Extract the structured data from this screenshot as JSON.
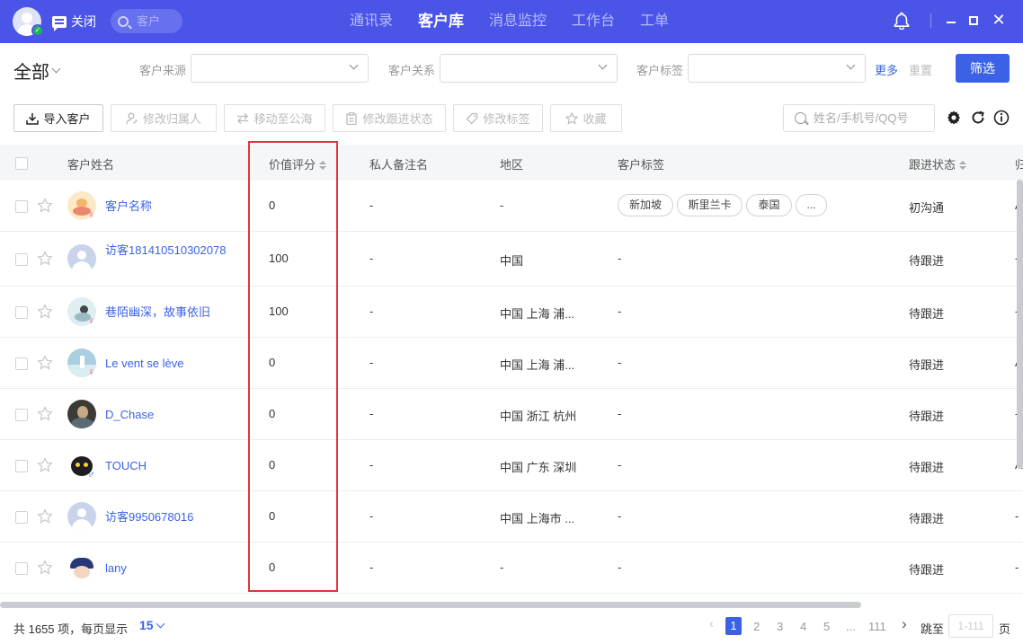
{
  "topbar": {
    "close_label": "关闭",
    "search_placeholder": "客户",
    "nav": [
      "通讯录",
      "客户库",
      "消息监控",
      "工作台",
      "工单"
    ],
    "active_nav": 1
  },
  "filters": {
    "scope": "全部",
    "source_label": "客户来源",
    "relation_label": "客户关系",
    "tag_label": "客户标签",
    "more": "更多",
    "reset": "重置",
    "submit": "筛选"
  },
  "toolbar": {
    "import": "导入客户",
    "change_owner": "修改归属人",
    "move_pool": "移动至公海",
    "change_status": "修改跟进状态",
    "change_tags": "修改标签",
    "favorite": "收藏",
    "search_placeholder": "姓名/手机号/QQ号"
  },
  "table": {
    "headers": {
      "name": "客户姓名",
      "score": "价值评分",
      "remark": "私人备注名",
      "region": "地区",
      "tags": "客户标签",
      "status": "跟进状态",
      "owner": "归"
    },
    "rows": [
      {
        "name": "客户名称",
        "score": "0",
        "remark": "-",
        "region": "-",
        "tags": [
          "新加坡",
          "斯里兰卡",
          "泰国",
          "..."
        ],
        "status": "初沟通",
        "owner": "A"
      },
      {
        "name": "访客181410510302078",
        "score": "100",
        "remark": "-",
        "region": "中国",
        "tags": [],
        "tags_text": "-",
        "status": "待跟进",
        "owner": "-"
      },
      {
        "name": "巷陌幽深，故事依旧",
        "score": "100",
        "remark": "-",
        "region": "中国 上海 浦...",
        "tags": [],
        "tags_text": "-",
        "status": "待跟进",
        "owner": "-"
      },
      {
        "name": "Le vent se lève",
        "score": "0",
        "remark": "-",
        "region": "中国 上海 浦...",
        "tags": [],
        "tags_text": "-",
        "status": "待跟进",
        "owner": "A"
      },
      {
        "name": "D_Chase",
        "score": "0",
        "remark": "-",
        "region": "中国 浙江 杭州",
        "tags": [],
        "tags_text": "-",
        "status": "待跟进",
        "owner": "-"
      },
      {
        "name": "TOUCH",
        "score": "0",
        "remark": "-",
        "region": "中国 广东 深圳",
        "tags": [],
        "tags_text": "-",
        "status": "待跟进",
        "owner": "A"
      },
      {
        "name": "访客9950678016",
        "score": "0",
        "remark": "-",
        "region": "中国 上海市 ...",
        "tags": [],
        "tags_text": "-",
        "status": "待跟进",
        "owner": "-"
      },
      {
        "name": "lany",
        "score": "0",
        "remark": "-",
        "region": "-",
        "tags": [],
        "tags_text": "-",
        "status": "待跟进",
        "owner": "-"
      }
    ]
  },
  "footer": {
    "total_text": "共 1655 项，每页显示",
    "page_size": "15",
    "pages": [
      "1",
      "2",
      "3",
      "4",
      "5",
      "...",
      "111"
    ],
    "jump_label": "跳至",
    "jump_placeholder": "1-111",
    "page_unit": "页"
  },
  "colors": {
    "topbar": "#4a55e8",
    "accent": "#3b62e6",
    "highlight": "#e0343b"
  }
}
